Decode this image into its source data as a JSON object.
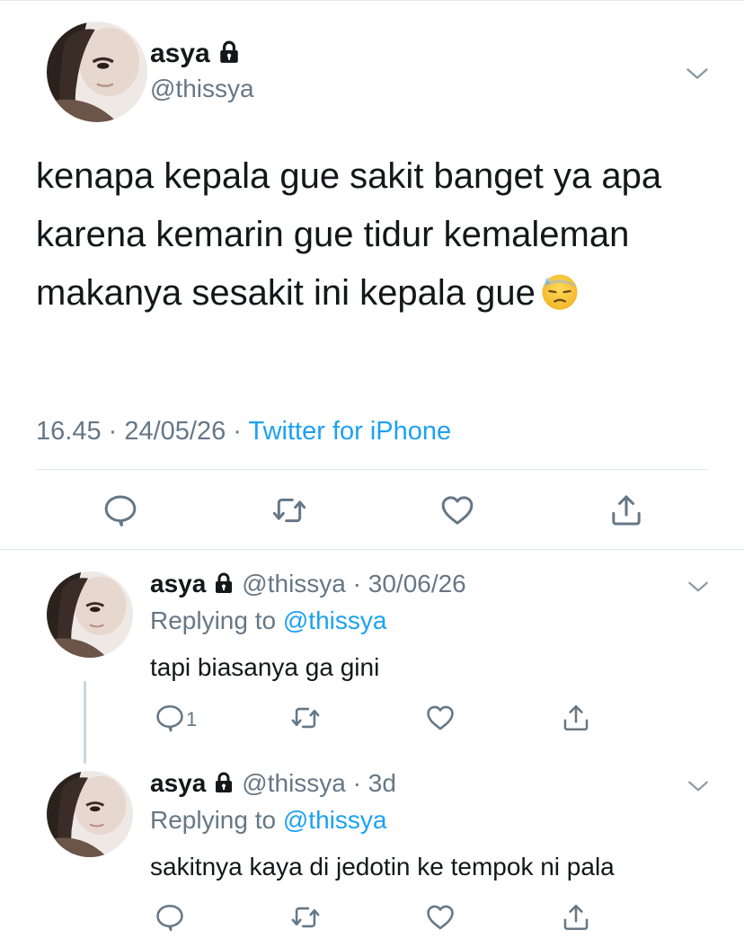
{
  "main_tweet": {
    "name": "asya",
    "handle": "@thissya",
    "text": "kenapa kepala gue sakit banget ya apa karena kemarin gue tidur kemaleman makanya sesakit ini kepala gue",
    "emoji": "downcast-face-with-sweat",
    "time": "16.45",
    "date": "24/05/26",
    "source": "Twitter for iPhone",
    "separator": " · "
  },
  "replies": [
    {
      "name": "asya",
      "handle": "@thissya",
      "time": "30/06/26",
      "replying_prefix": "Replying to ",
      "replying_to": "@thissya",
      "text": "tapi biasanya ga gini",
      "reply_count": "1"
    },
    {
      "name": "asya",
      "handle": "@thissya",
      "time": "3d",
      "replying_prefix": "Replying to ",
      "replying_to": "@thissya",
      "text": "sakitnya kaya di jedotin ke tempok ni pala",
      "reply_count": ""
    }
  ],
  "icons": [
    "lock-icon",
    "chevron-down-icon",
    "reply-icon",
    "retweet-icon",
    "like-icon",
    "share-icon"
  ],
  "colors": {
    "link": "#1da1f2",
    "secondary": "#657786",
    "text": "#14171a",
    "divider": "#e1e8ed"
  }
}
